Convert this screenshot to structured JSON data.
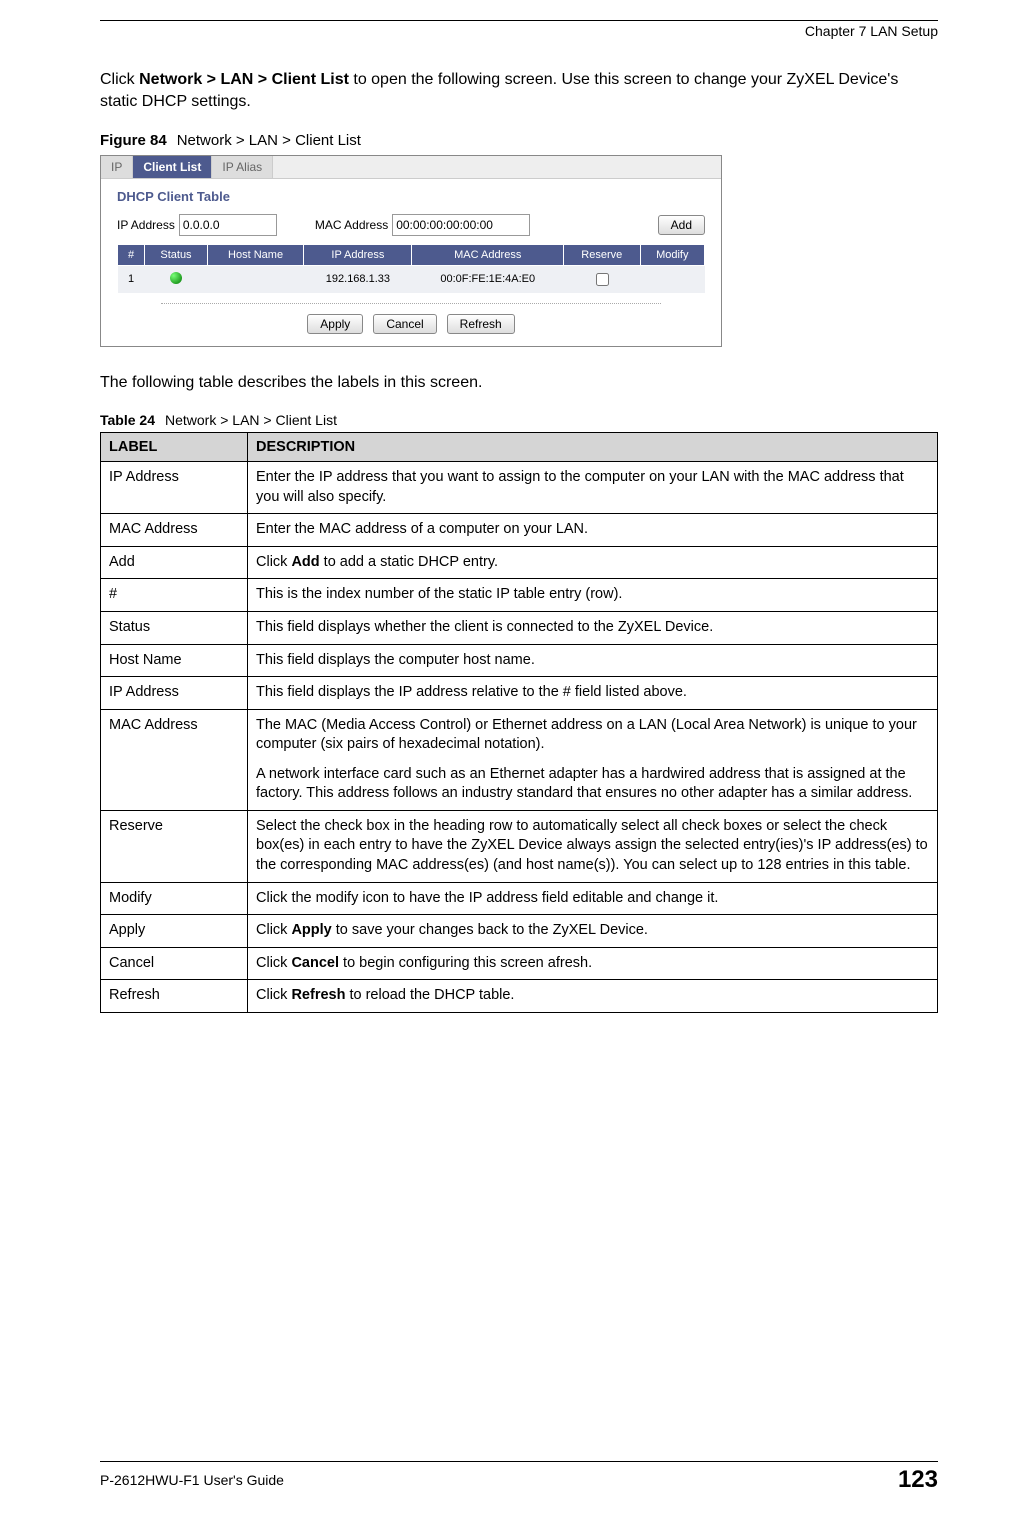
{
  "header": {
    "chapter": "Chapter 7 LAN Setup"
  },
  "intro": {
    "text": "Click Network > LAN > Client List to open the following screen. Use this screen to change your ZyXEL Device's static DHCP settings.",
    "nav_bold": "Network > LAN > Client List"
  },
  "figure": {
    "label": "Figure 84",
    "caption": "Network > LAN > Client List"
  },
  "screenshot": {
    "tabs": {
      "ip": "IP",
      "client_list": "Client List",
      "ip_alias": "IP Alias"
    },
    "section_title": "DHCP Client Table",
    "ip_label": "IP Address",
    "ip_value": "0.0.0.0",
    "mac_label": "MAC Address",
    "mac_value": "00:00:00:00:00:00",
    "add_btn": "Add",
    "columns": {
      "num": "#",
      "status": "Status",
      "host": "Host Name",
      "ip": "IP Address",
      "mac": "MAC Address",
      "reserve": "Reserve",
      "modify": "Modify"
    },
    "row1": {
      "num": "1",
      "host": "",
      "ip": "192.168.1.33",
      "mac": "00:0F:FE:1E:4A:E0"
    },
    "buttons": {
      "apply": "Apply",
      "cancel": "Cancel",
      "refresh": "Refresh"
    }
  },
  "mid_text": "The following table describes the labels in this screen.",
  "table": {
    "label": "Table 24",
    "caption": "Network > LAN > Client List",
    "headers": {
      "label": "LABEL",
      "desc": "DESCRIPTION"
    },
    "rows": [
      {
        "label": "IP Address",
        "desc": "Enter the IP address that you want to assign to the computer on your LAN with the MAC address that you will also specify."
      },
      {
        "label": "MAC Address",
        "desc": "Enter the MAC address of a computer on your LAN."
      },
      {
        "label": "Add",
        "desc_pre": "Click ",
        "desc_bold": "Add",
        "desc_post": " to add a static DHCP entry."
      },
      {
        "label": "#",
        "desc": "This is the index number of the static IP table entry (row)."
      },
      {
        "label": "Status",
        "desc": "This field displays whether the client is connected to the ZyXEL Device."
      },
      {
        "label": "Host Name",
        "desc": "This field displays the computer host name."
      },
      {
        "label": "IP Address",
        "desc": "This field displays the IP address relative to the # field listed above."
      },
      {
        "label": "MAC Address",
        "desc_p1": "The MAC (Media Access Control) or Ethernet address on a LAN (Local Area Network) is unique to your computer (six pairs of hexadecimal notation).",
        "desc_p2": "A network interface card such as an Ethernet adapter has a hardwired address that is assigned at the factory. This address follows an industry standard that ensures no other adapter has a similar address."
      },
      {
        "label": "Reserve",
        "desc": "Select the check box in the heading row to automatically select all check boxes or select the check box(es) in each entry to have the ZyXEL Device always assign the selected entry(ies)'s IP address(es) to the corresponding MAC address(es) (and host name(s)). You can select up to 128 entries in this table."
      },
      {
        "label": "Modify",
        "desc": "Click the modify icon to have the IP address field editable and change it."
      },
      {
        "label": "Apply",
        "desc_pre": "Click ",
        "desc_bold": "Apply",
        "desc_post": " to save your changes back to the ZyXEL Device."
      },
      {
        "label": "Cancel",
        "desc_pre": "Click ",
        "desc_bold": "Cancel",
        "desc_post": " to begin configuring this screen afresh."
      },
      {
        "label": "Refresh",
        "desc_pre": "Click ",
        "desc_bold": "Refresh",
        "desc_post": " to reload the DHCP table."
      }
    ]
  },
  "footer": {
    "guide": "P-2612HWU-F1 User's Guide",
    "page": "123"
  }
}
